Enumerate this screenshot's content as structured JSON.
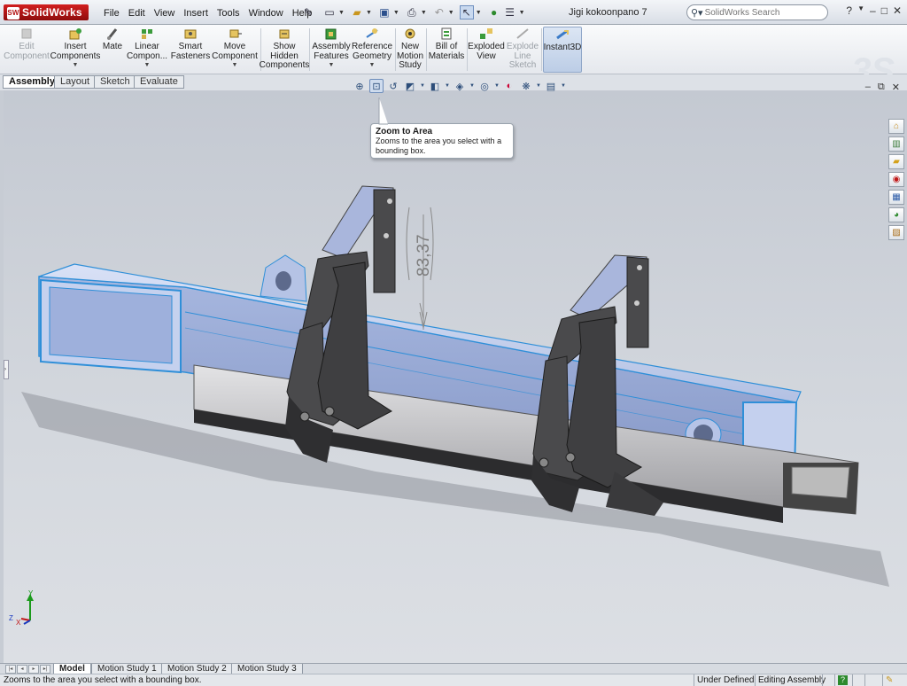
{
  "app": {
    "brand": "SolidWorks",
    "document_title": "Jigi kokoonpano 7"
  },
  "menu": [
    "File",
    "Edit",
    "View",
    "Insert",
    "Tools",
    "Window",
    "Help"
  ],
  "search": {
    "placeholder": "SolidWorks Search"
  },
  "help_label": "?",
  "commands": {
    "edit_component": "Edit Component",
    "insert_components": "Insert Components",
    "mate": "Mate",
    "linear_component": "Linear Compon...",
    "smart_fasteners": "Smart Fasteners",
    "move_component": "Move Component",
    "show_hidden": "Show Hidden Components",
    "assembly_features": "Assembly Features",
    "reference_geometry": "Reference Geometry",
    "new_motion_study": "New Motion Study",
    "bill_of_materials": "Bill of Materials",
    "exploded_view": "Exploded View",
    "explode_line_sketch": "Explode Line Sketch",
    "instant3d": "Instant3D"
  },
  "cm_tabs": [
    "Assembly",
    "Layout",
    "Sketch",
    "Evaluate"
  ],
  "tooltip": {
    "title": "Zoom to Area",
    "body": "Zooms to the area you select with a bounding box."
  },
  "dimension": "83,37",
  "triad": {
    "x": "X",
    "y": "Y",
    "z": "Z"
  },
  "bottom_tabs": [
    "Model",
    "Motion Study 1",
    "Motion Study 2",
    "Motion Study 3"
  ],
  "status": {
    "message": "Zooms to the area you select with a bounding box.",
    "state": "Under Defined",
    "mode": "Editing Assembly",
    "help": "?"
  },
  "colors": {
    "brand_red": "#c01717",
    "selection_blue": "#2f8fd8",
    "part_blue": "#aab9de",
    "fixture_gray": "#4a4a4c"
  },
  "icons": {
    "headsup": [
      "zoom-to-fit-icon",
      "zoom-to-area-icon",
      "previous-view-icon",
      "section-view-icon",
      "view-orientation-icon",
      "display-style-icon",
      "hide-show-items-icon",
      "edit-appearance-icon",
      "apply-scene-icon",
      "view-settings-icon"
    ],
    "taskpane": [
      "home-icon",
      "design-library-icon",
      "file-explorer-icon",
      "view-palette-icon",
      "appearances-icon",
      "custom-properties-icon",
      "scenes-icon"
    ]
  }
}
